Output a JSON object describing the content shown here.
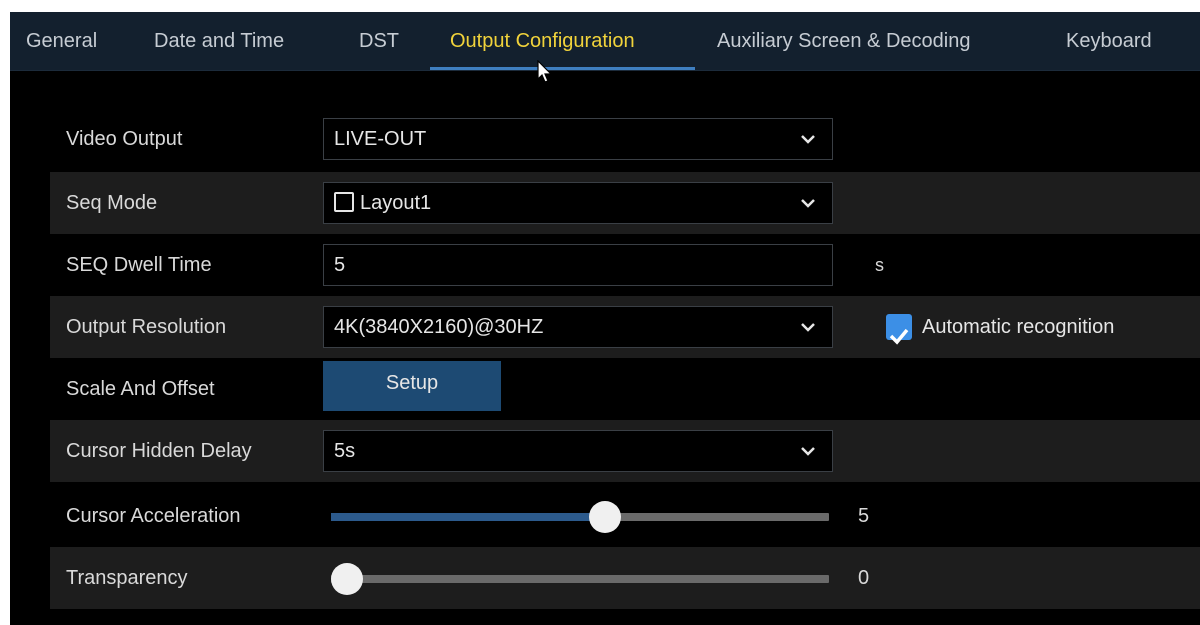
{
  "tabs": [
    {
      "label": "General",
      "active": false
    },
    {
      "label": "Date and Time",
      "active": false
    },
    {
      "label": "DST",
      "active": false
    },
    {
      "label": "Output Configuration",
      "active": true
    },
    {
      "label": "Auxiliary Screen & Decoding",
      "active": false
    },
    {
      "label": "Keyboard",
      "active": false
    }
  ],
  "colors": {
    "active_tab": "#f1d33b",
    "accent": "#3c8fe6",
    "button": "#1d4a73"
  },
  "settings": {
    "video_output": {
      "label": "Video Output",
      "value": "LIVE-OUT",
      "icon": "chevron-down-icon"
    },
    "seq_mode": {
      "label": "Seq Mode",
      "value": "Layout1",
      "checked": false,
      "icon": "chevron-down-icon"
    },
    "seq_dwell_time": {
      "label": "SEQ Dwell Time",
      "value": "5",
      "unit": "s"
    },
    "output_resolution": {
      "label": "Output Resolution",
      "value": "4K(3840X2160)@30HZ",
      "auto_label": "Automatic recognition",
      "auto_checked": true,
      "icon": "chevron-down-icon"
    },
    "scale_and_offset": {
      "label": "Scale And Offset",
      "button": "Setup"
    },
    "cursor_hidden_delay": {
      "label": "Cursor Hidden Delay",
      "value": "5s",
      "icon": "chevron-down-icon"
    },
    "cursor_acceleration": {
      "label": "Cursor Acceleration",
      "value": "5",
      "level": 0.55
    },
    "transparency": {
      "label": "Transparency",
      "value": "0",
      "level": 0.0
    }
  }
}
